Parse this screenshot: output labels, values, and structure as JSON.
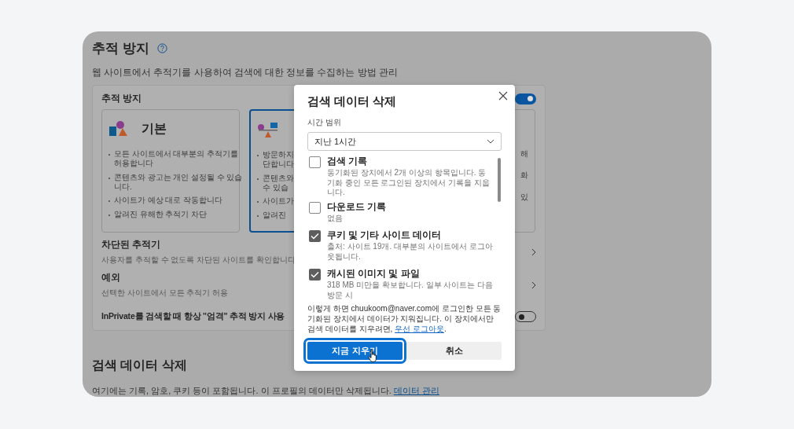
{
  "page": {
    "tracking": {
      "title": "추적 방지",
      "description": "웹 사이트에서 추적기를 사용하여 검색에 대한 정보를 수집하는 방법 관리",
      "box_label": "추적 방지",
      "toggle_on": true,
      "cards": [
        {
          "title": "기본",
          "selected": false,
          "bullets": [
            "모든 사이트에서 대부분의 추적기를\n허용합니다",
            "콘텐츠와 광고는 개인 설정될 수 있습\n니다.",
            "사이트가 예상 대로 작동합니다",
            "알려진 유해한 추적기 차단"
          ]
        },
        {
          "selected": true,
          "bullets": [
            "방문하지\n단합니다",
            "콘텐츠와\n수 있습",
            "사이트가",
            "알려진"
          ]
        },
        {
          "selected": false,
          "bullets": [
            "해",
            "화",
            "있"
          ]
        }
      ],
      "rows": [
        {
          "title": "차단된 추적기",
          "subtitle": "사용자를 추적할 수 없도록 차단된 사이트를 확인합니다"
        },
        {
          "title": "예외",
          "subtitle": "선택한 사이트에서 모든 추적기 허용"
        }
      ],
      "inprivate": {
        "label": "InPrivate를 검색할 때 항상 \"엄격\" 추적 방지 사용",
        "on": false
      }
    },
    "clear": {
      "title": "검색 데이터 삭제",
      "description": "여기에는 기록, 암호, 쿠키 등이 포함됩니다. 이 프로필의 데이터만 삭제됩니다.",
      "link": "데이터 관리"
    }
  },
  "dialog": {
    "title": "검색 데이터 삭제",
    "range_label": "시간 범위",
    "range_value": "지난 1시간",
    "items": [
      {
        "title": "검색 기록",
        "detail": "동기화된 장치에서 2개 이상의 항목입니다. 동기화 중인 모든 로그인된 장치에서 기록을 지웁니다.",
        "checked": false
      },
      {
        "title": "다운로드 기록",
        "detail": "없음",
        "checked": false
      },
      {
        "title": "쿠키 및 기타 사이트 데이터",
        "detail": "출처: 사이트 19개. 대부분의 사이트에서 로그아웃됩니다.",
        "checked": true
      },
      {
        "title": "캐시된 이미지 및 파일",
        "detail": "318 MB 미만을 확보합니다. 일부 사이트는 다음 방문 시",
        "checked": true
      }
    ],
    "note": "이렇게 하면 chuukoom@naver.com에 로그인한 모든 동기화된 장치에서 데이터가 지워집니다. 이 장치에서만 검색 데이터를 지우려면, ",
    "note_link": "우선 로그아웃",
    "note_end": ".",
    "buttons": [
      {
        "label": "지금 지우기",
        "kind": "primary"
      },
      {
        "label": "취소",
        "kind": "secondary"
      }
    ]
  }
}
